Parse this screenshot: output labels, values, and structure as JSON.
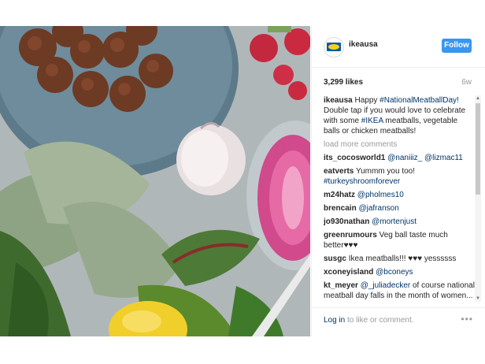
{
  "post": {
    "username": "ikeausa",
    "follow_label": "Follow",
    "likes": "3,299 likes",
    "time_ago": "6w",
    "comments_placeholder_more": "load more comments",
    "footer_login": "Log in",
    "footer_rest": " to like or comment.",
    "options_glyph": "•••",
    "caption": [
      {
        "text": "Happy ",
        "tag": false
      },
      {
        "text": "#NationalMeatballDay!",
        "tag": true
      },
      {
        "text": " Double tap if you would love to celebrate with some ",
        "tag": false
      },
      {
        "text": "#IKEA",
        "tag": true
      },
      {
        "text": " meatballs, vegetable balls or chicken meatballs!",
        "tag": false
      }
    ],
    "comments": [
      {
        "user": "its_cocosworld1",
        "parts": [
          {
            "text": "@naniiiz_",
            "tag": true
          },
          {
            "text": " ",
            "tag": false
          },
          {
            "text": "@lizmac11",
            "tag": true
          }
        ]
      },
      {
        "user": "eatverts",
        "parts": [
          {
            "text": "Yummm you too! ",
            "tag": false
          },
          {
            "text": "#turkeyshroomforever",
            "tag": true
          }
        ]
      },
      {
        "user": "m24hatz",
        "parts": [
          {
            "text": "@pholmes10",
            "tag": true
          }
        ]
      },
      {
        "user": "brencain",
        "parts": [
          {
            "text": "@jafranson",
            "tag": true
          }
        ]
      },
      {
        "user": "jo930nathan",
        "parts": [
          {
            "text": "@mortenjust",
            "tag": true
          }
        ]
      },
      {
        "user": "greenrumours",
        "parts": [
          {
            "text": "Veg ball taste much better♥♥♥",
            "tag": false
          }
        ]
      },
      {
        "user": "susgc",
        "parts": [
          {
            "text": "Ikea meatballs!!! ♥♥♥ yessssss",
            "tag": false
          }
        ]
      },
      {
        "user": "xconeyisland",
        "parts": [
          {
            "text": "@bconeys",
            "tag": true
          }
        ]
      },
      {
        "user": "kt_meyer",
        "parts": [
          {
            "text": "@_juliadecker",
            "tag": true
          },
          {
            "text": " of course national meatball day falls in the month of women... □",
            "tag": false
          }
        ]
      }
    ]
  },
  "colors": {
    "follow_button": "#3897f0",
    "link": "#003569",
    "muted": "#999999"
  }
}
